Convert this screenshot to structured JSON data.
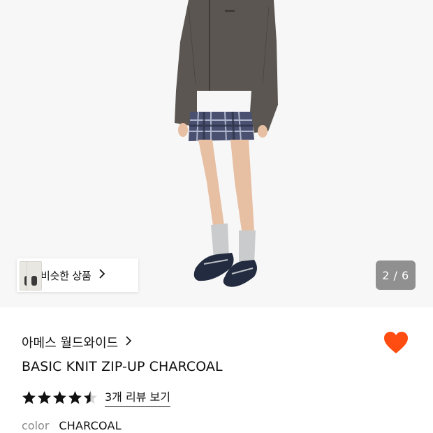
{
  "gallery": {
    "similar_label": "비슷한 상품",
    "counter": "2 / 6"
  },
  "product": {
    "brand": "아메스 월드와이드",
    "title": "BASIC KNIT ZIP-UP CHARCOAL",
    "rating": 4.5,
    "review_link": "3개 리뷰 보기",
    "color_label": "color",
    "color_value": "CHARCOAL",
    "liked": true
  },
  "colors": {
    "heart": "#ff4d12",
    "star": "#111111",
    "counter_bg": "#5a5a5a"
  },
  "icons": {
    "brand_chevron": "chevron-right-icon",
    "similar_chevron": "chevron-right-icon",
    "like": "heart-icon",
    "rating": "star-icon"
  }
}
